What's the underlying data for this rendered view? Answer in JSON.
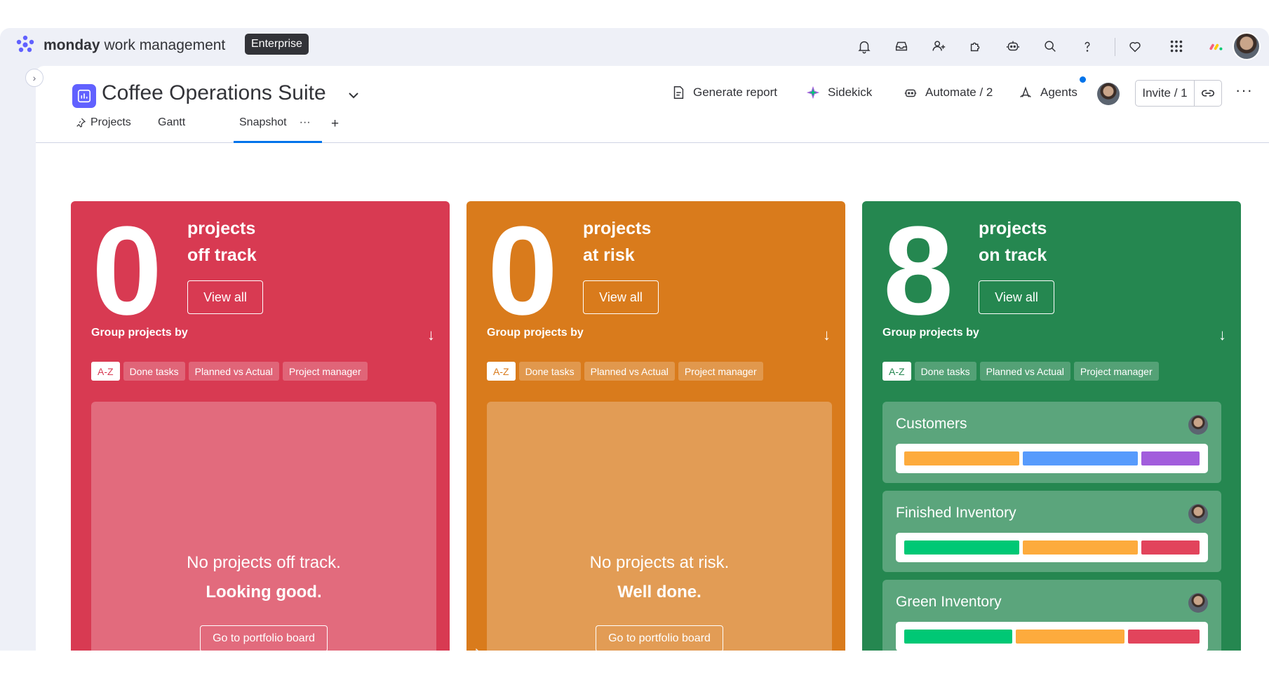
{
  "app": {
    "brand_bold": "monday",
    "brand_rest": "work management",
    "plan_badge": "Enterprise"
  },
  "board": {
    "title": "Coffee Operations Suite",
    "actions": {
      "generate_report": "Generate report",
      "sidekick": "Sidekick",
      "automate": "Automate / 2",
      "agents": "Agents",
      "invite": "Invite / 1"
    },
    "tabs": [
      "Projects",
      "Gantt",
      "Snapshot"
    ]
  },
  "cards": [
    {
      "count": "0",
      "title_line1": "projects",
      "title_line2": "off track",
      "view_all": "View all",
      "group_by": "Group projects by",
      "chips": [
        "A-Z",
        "Done tasks",
        "Planned vs Actual",
        "Project manager"
      ],
      "empty_msg": "No projects off track.",
      "empty_bold": "Looking good.",
      "portfolio_btn": "Go to portfolio board",
      "color": "#d83a52"
    },
    {
      "count": "0",
      "title_line1": "projects",
      "title_line2": "at risk",
      "view_all": "View all",
      "group_by": "Group projects by",
      "chips": [
        "A-Z",
        "Done tasks",
        "Planned vs Actual",
        "Project manager"
      ],
      "empty_msg": "No projects at risk.",
      "empty_bold": "Well done.",
      "portfolio_btn": "Go to portfolio board",
      "color": "#d97b1c"
    },
    {
      "count": "8",
      "title_line1": "projects",
      "title_line2": "on track",
      "view_all": "View all",
      "group_by": "Group projects by",
      "chips": [
        "A-Z",
        "Done tasks",
        "Planned vs Actual",
        "Project manager"
      ],
      "color": "#258750",
      "projects": [
        {
          "name": "Customers",
          "bar_colors": [
            "#fdab3d",
            "#579bfc",
            "#a25ddc"
          ]
        },
        {
          "name": "Finished Inventory",
          "bar_colors": [
            "#00c875",
            "#fdab3d",
            "#e2445c"
          ]
        },
        {
          "name": "Green Inventory",
          "bar_colors": [
            "#00c875",
            "#fdab3d",
            "#e2445c"
          ]
        }
      ]
    }
  ],
  "icons": {
    "top": [
      "bell-icon",
      "inbox-icon",
      "invite-user-icon",
      "apps-icon",
      "ai-bot-icon",
      "search-icon",
      "help-icon",
      "heart-icon",
      "grid-menu-icon"
    ],
    "brand_accent": "#6161ff"
  }
}
